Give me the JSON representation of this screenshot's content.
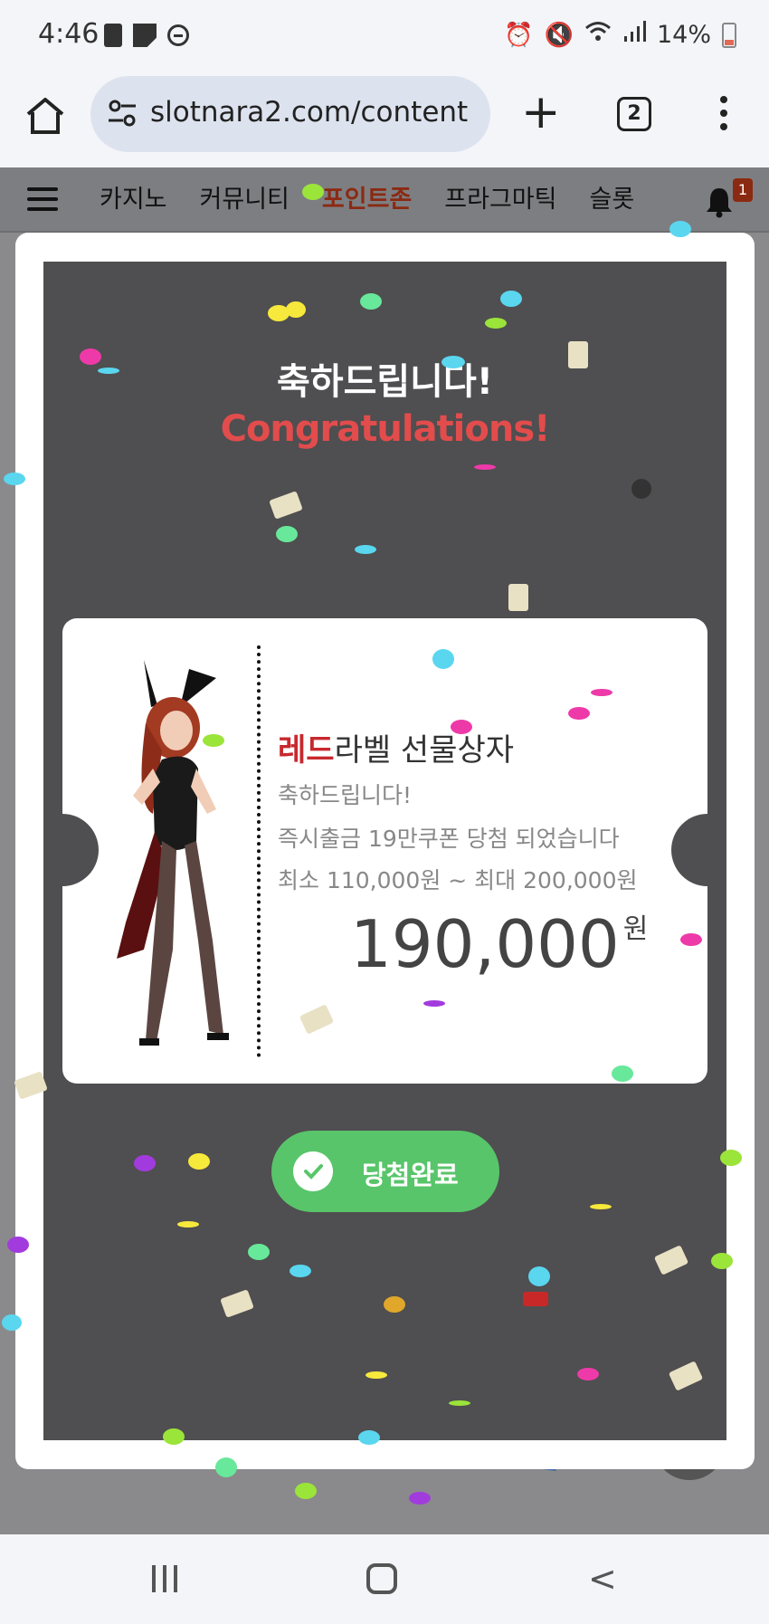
{
  "status_bar": {
    "time": "4:46",
    "battery": "14%"
  },
  "browser": {
    "url": "slotnara2.com/content",
    "tab_count": "2"
  },
  "site_nav": {
    "items": [
      "카지노",
      "커뮤니티",
      "포인트존",
      "프라그마틱",
      "슬롯"
    ],
    "active": "포인트존",
    "notification_count": "1"
  },
  "modal": {
    "title_kr": "축하드립니다!",
    "title_en": "Congratulations!",
    "prize": {
      "title_highlight": "레드",
      "title_rest": "라벨 선물상자",
      "line1": "축하드립니다!",
      "line2": "즉시출금 19만쿠폰 당첨 되었습니다",
      "line3": "최소 110,000원 ~ 최대 200,000원",
      "amount": "190,000",
      "unit": "원"
    },
    "button_label": "당첨완료"
  },
  "colors": {
    "accent_red": "#e24c4c",
    "button_green": "#58c56a",
    "panel_dark": "#4f4e50"
  }
}
